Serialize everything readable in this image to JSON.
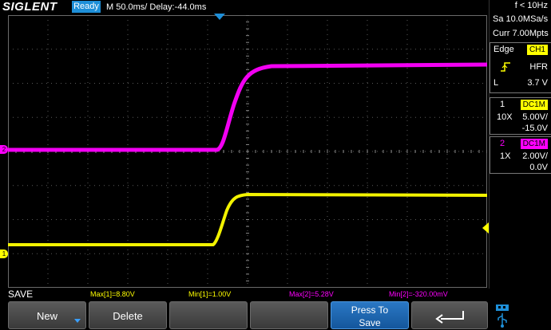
{
  "header": {
    "brand": "SIGLENT",
    "status": "Ready",
    "timebase": "M 50.0ms/ Delay:-44.0ms",
    "frequency": "f < 10Hz"
  },
  "acquisition": {
    "sample_rate": "Sa 10.0MSa/s",
    "memory": "Curr 7.00Mpts"
  },
  "trigger": {
    "type": "Edge",
    "source": "CH1",
    "coupling": "HFR",
    "level_label": "L",
    "level": "3.7 V"
  },
  "channels": [
    {
      "id": "1",
      "coupling": "DC1M",
      "probe": "10X",
      "scale": "5.00V/",
      "offset": "-15.0V",
      "color": "#ffff00"
    },
    {
      "id": "2",
      "coupling": "DC1M",
      "probe": "1X",
      "scale": "2.00V/",
      "offset": "0.0V",
      "color": "#ff00ff"
    }
  ],
  "markers": {
    "ch1": "1",
    "ch2": "2"
  },
  "measurements": {
    "panel_title": "SAVE",
    "max1": "Max[1]=8.80V",
    "min1": "Min[1]=1.00V",
    "max2": "Max[2]=5.28V",
    "min2": "Min[2]=-320.00mV"
  },
  "softkeys": {
    "new": "New",
    "delete": "Delete",
    "press_to": "Press To",
    "save": "Save"
  },
  "colors": {
    "ch1": "#ffff00",
    "ch2": "#ff00ff",
    "accent": "#1e8fd8",
    "grid": "#5a5a5a"
  }
}
